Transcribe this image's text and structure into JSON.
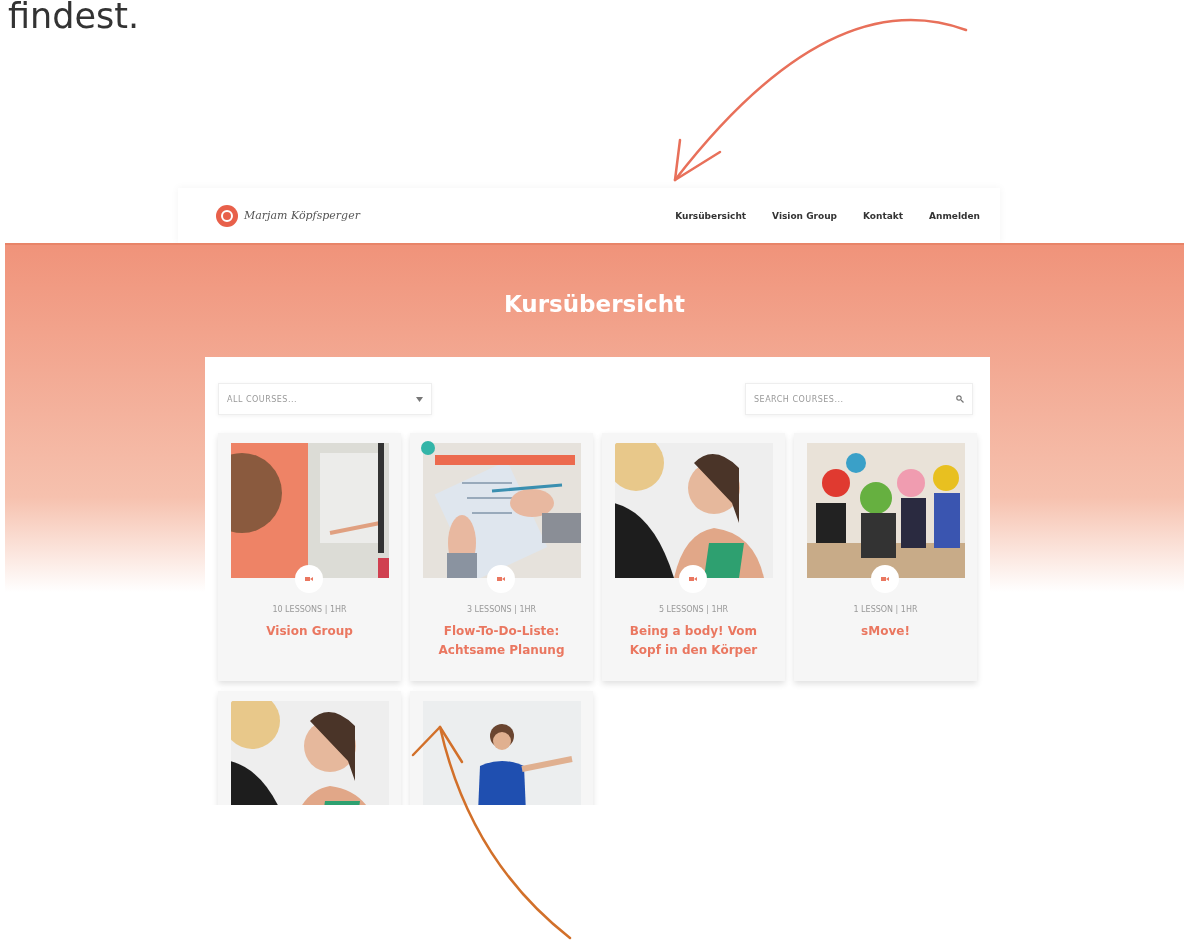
{
  "intro_text": "findest.",
  "site": {
    "logo_text": "Marjam Köpfsperger",
    "nav": [
      {
        "label": "Kursübersicht"
      },
      {
        "label": "Vision Group"
      },
      {
        "label": "Kontakt"
      },
      {
        "label": "Anmelden"
      }
    ],
    "page_title": "Kursübersicht",
    "filter": {
      "placeholder": "ALL COURSES..."
    },
    "search": {
      "placeholder": "SEARCH COURSES..."
    },
    "courses": [
      {
        "meta": "10 LESSONS | 1HR",
        "title": "Vision Group",
        "ribbon": false
      },
      {
        "meta": "3 LESSONS | 1HR",
        "title": "Flow-To-Do-Liste: Achtsame Planung",
        "ribbon": true
      },
      {
        "meta": "5 LESSONS | 1HR",
        "title": "Being a body! Vom Kopf in den Körper",
        "ribbon": false
      },
      {
        "meta": "1 LESSON | 1HR",
        "title": "sMove!",
        "ribbon": false
      },
      {
        "ribbon": false
      },
      {
        "ribbon": false
      }
    ]
  }
}
